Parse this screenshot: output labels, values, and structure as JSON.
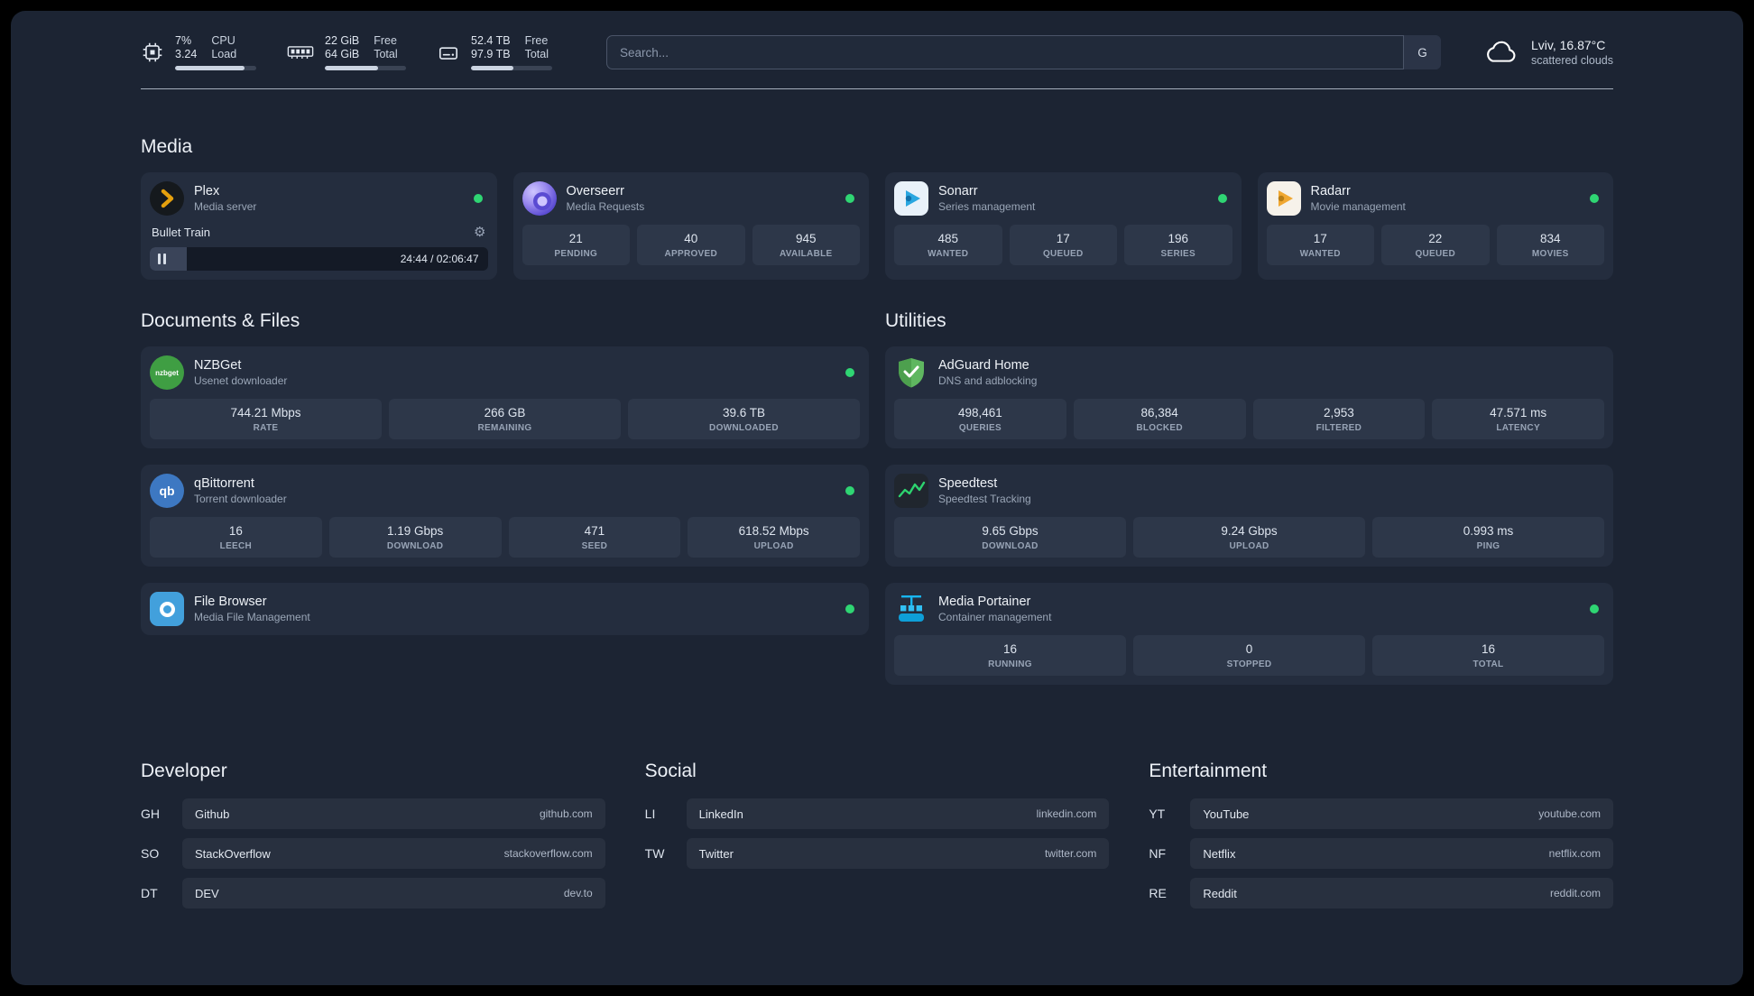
{
  "topbar": {
    "resources": [
      {
        "value_top": "7%",
        "value_bottom": "3.24",
        "label_top": "CPU",
        "label_bottom": "Load",
        "progress": 86
      },
      {
        "value_top": "22 GiB",
        "value_bottom": "64 GiB",
        "label_top": "Free",
        "label_bottom": "Total",
        "progress": 66
      },
      {
        "value_top": "52.4 TB",
        "value_bottom": "97.9 TB",
        "label_top": "Free",
        "label_bottom": "Total",
        "progress": 52
      }
    ],
    "search": {
      "placeholder": "Search...",
      "button_label": "G"
    },
    "weather": {
      "location": "Lviv, 16.87°C",
      "condition": "scattered clouds"
    }
  },
  "groups": {
    "media": {
      "title": "Media",
      "plex": {
        "name": "Plex",
        "description": "Media server",
        "now_playing": {
          "title": "Bullet Train",
          "time": "24:44 / 02:06:47",
          "progress": 11
        }
      },
      "overseerr": {
        "name": "Overseerr",
        "description": "Media Requests",
        "stats": [
          {
            "value": "21",
            "label": "PENDING"
          },
          {
            "value": "40",
            "label": "APPROVED"
          },
          {
            "value": "945",
            "label": "AVAILABLE"
          }
        ]
      },
      "sonarr": {
        "name": "Sonarr",
        "description": "Series management",
        "stats": [
          {
            "value": "485",
            "label": "WANTED"
          },
          {
            "value": "17",
            "label": "QUEUED"
          },
          {
            "value": "196",
            "label": "SERIES"
          }
        ]
      },
      "radarr": {
        "name": "Radarr",
        "description": "Movie management",
        "stats": [
          {
            "value": "17",
            "label": "WANTED"
          },
          {
            "value": "22",
            "label": "QUEUED"
          },
          {
            "value": "834",
            "label": "MOVIES"
          }
        ]
      }
    },
    "documents": {
      "title": "Documents & Files",
      "nzbget": {
        "name": "NZBGet",
        "description": "Usenet downloader",
        "logo_text": "nzbget",
        "stats": [
          {
            "value": "744.21 Mbps",
            "label": "RATE"
          },
          {
            "value": "266 GB",
            "label": "REMAINING"
          },
          {
            "value": "39.6 TB",
            "label": "DOWNLOADED"
          }
        ]
      },
      "qbittorrent": {
        "name": "qBittorrent",
        "description": "Torrent downloader",
        "logo_text": "qb",
        "stats": [
          {
            "value": "16",
            "label": "LEECH"
          },
          {
            "value": "1.19 Gbps",
            "label": "DOWNLOAD"
          },
          {
            "value": "471",
            "label": "SEED"
          },
          {
            "value": "618.52 Mbps",
            "label": "UPLOAD"
          }
        ]
      },
      "filebrowser": {
        "name": "File Browser",
        "description": "Media File Management"
      }
    },
    "utilities": {
      "title": "Utilities",
      "adguard": {
        "name": "AdGuard Home",
        "description": "DNS and adblocking",
        "stats": [
          {
            "value": "498,461",
            "label": "QUERIES"
          },
          {
            "value": "86,384",
            "label": "BLOCKED"
          },
          {
            "value": "2,953",
            "label": "FILTERED"
          },
          {
            "value": "47.571 ms",
            "label": "LATENCY"
          }
        ]
      },
      "speedtest": {
        "name": "Speedtest",
        "description": "Speedtest Tracking",
        "stats": [
          {
            "value": "9.65 Gbps",
            "label": "DOWNLOAD"
          },
          {
            "value": "9.24 Gbps",
            "label": "UPLOAD"
          },
          {
            "value": "0.993 ms",
            "label": "PING"
          }
        ]
      },
      "portainer": {
        "name": "Media Portainer",
        "description": "Container management",
        "stats": [
          {
            "value": "16",
            "label": "RUNNING"
          },
          {
            "value": "0",
            "label": "STOPPED"
          },
          {
            "value": "16",
            "label": "TOTAL"
          }
        ]
      }
    }
  },
  "bookmarks": {
    "developer": {
      "title": "Developer",
      "items": [
        {
          "abbr": "GH",
          "name": "Github",
          "domain": "github.com"
        },
        {
          "abbr": "SO",
          "name": "StackOverflow",
          "domain": "stackoverflow.com"
        },
        {
          "abbr": "DT",
          "name": "DEV",
          "domain": "dev.to"
        }
      ]
    },
    "social": {
      "title": "Social",
      "items": [
        {
          "abbr": "LI",
          "name": "LinkedIn",
          "domain": "linkedin.com"
        },
        {
          "abbr": "TW",
          "name": "Twitter",
          "domain": "twitter.com"
        }
      ]
    },
    "entertainment": {
      "title": "Entertainment",
      "items": [
        {
          "abbr": "YT",
          "name": "YouTube",
          "domain": "youtube.com"
        },
        {
          "abbr": "NF",
          "name": "Netflix",
          "domain": "netflix.com"
        },
        {
          "abbr": "RE",
          "name": "Reddit",
          "domain": "reddit.com"
        }
      ]
    }
  },
  "colors": {
    "background": "#1c2433",
    "card": "#242d3e",
    "status_online": "#2fd573",
    "accent_plex": "#e5a00d"
  }
}
